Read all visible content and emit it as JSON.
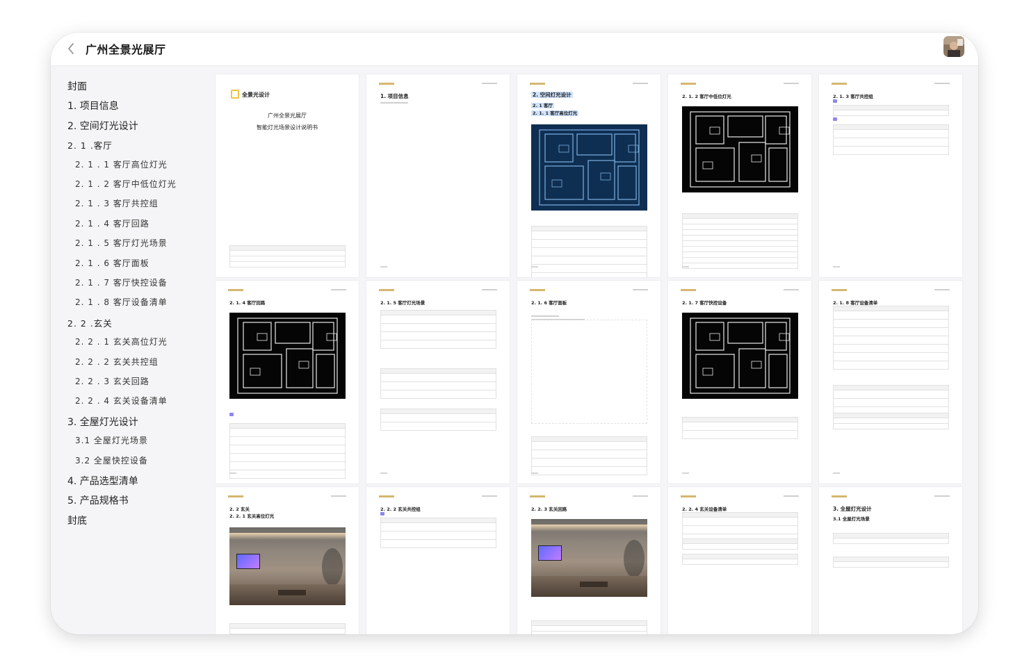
{
  "header": {
    "title": "广州全景光展厅",
    "back_icon": "chevron-left-icon",
    "avatar_icon": "user-avatar-icon"
  },
  "toc": [
    {
      "label": "封面",
      "level": 1
    },
    {
      "label": "1. 项目信息",
      "level": 1
    },
    {
      "label": "2. 空间灯光设计",
      "level": 1
    },
    {
      "label": "2. 1 .客厅",
      "level": 2
    },
    {
      "label": "2. 1 . 1 客厅高位灯光",
      "level": 3
    },
    {
      "label": "2. 1 . 2 客厅中低位灯光",
      "level": 3
    },
    {
      "label": "2. 1 . 3 客厅共控组",
      "level": 3
    },
    {
      "label": "2. 1 . 4 客厅回路",
      "level": 3
    },
    {
      "label": "2. 1 . 5 客厅灯光场景",
      "level": 3
    },
    {
      "label": "2. 1 . 6 客厅面板",
      "level": 3
    },
    {
      "label": "2. 1 . 7 客厅快控设备",
      "level": 3
    },
    {
      "label": "2. 1 . 8 客厅设备清单",
      "level": 3
    },
    {
      "label": "2. 2 .玄关",
      "level": 2
    },
    {
      "label": "2. 2 . 1 玄关高位灯光",
      "level": 3
    },
    {
      "label": "2. 2 . 2 玄关共控组",
      "level": 3
    },
    {
      "label": "2. 2 . 3 玄关回路",
      "level": 3
    },
    {
      "label": "2. 2 . 4 玄关设备清单",
      "level": 3
    },
    {
      "label": "3. 全屋灯光设计",
      "level": 1
    },
    {
      "label": "3.1 全屋灯光场景",
      "level": 3
    },
    {
      "label": "3.2 全屋快控设备",
      "level": 3
    },
    {
      "label": "4. 产品选型清单",
      "level": 1
    },
    {
      "label": "5. 产品规格书",
      "level": 1
    },
    {
      "label": "封底",
      "level": 1
    }
  ],
  "pages": [
    {
      "kind": "cover",
      "brand": "全景光设计",
      "line1": "广州全景光展厅",
      "line2": "智能灯光场景设计说明书"
    },
    {
      "kind": "text",
      "heading": "1. 项目信息"
    },
    {
      "kind": "plan-blue",
      "heading": "2. 空间灯光设计",
      "sub1": "2. 1 客厅",
      "sub2": "2. 1. 1 客厅高位灯光"
    },
    {
      "kind": "plan",
      "heading": "2. 1. 2 客厅中低位灯光"
    },
    {
      "kind": "table",
      "heading": "2. 1. 3 客厅共控组"
    },
    {
      "kind": "plan",
      "heading": "2. 1. 4 客厅回路"
    },
    {
      "kind": "table",
      "heading": "2. 1. 5 客厅灯光场景"
    },
    {
      "kind": "sketch",
      "heading": "2. 1. 6 客厅面板"
    },
    {
      "kind": "plan",
      "heading": "2. 1. 7 客厅快控设备"
    },
    {
      "kind": "table",
      "heading": "2. 1. 8 客厅设备清单"
    },
    {
      "kind": "photo",
      "heading": "2. 2 玄关",
      "sub1": "2. 2. 1 玄关高位灯光"
    },
    {
      "kind": "table-small",
      "heading": "2. 2. 2 玄关共控组"
    },
    {
      "kind": "photo",
      "heading": "2. 2. 3 玄关回路"
    },
    {
      "kind": "table-small",
      "heading": "2. 2. 4 玄关设备清单"
    },
    {
      "kind": "table-small",
      "heading": "3. 全屋灯光设计",
      "sub1": "3.1 全屋灯光场景"
    }
  ],
  "colors": {
    "accent_yellow": "#f2c43a",
    "highlight_blue": "#cfe3ff",
    "badge_purple": "#8e86f0"
  }
}
